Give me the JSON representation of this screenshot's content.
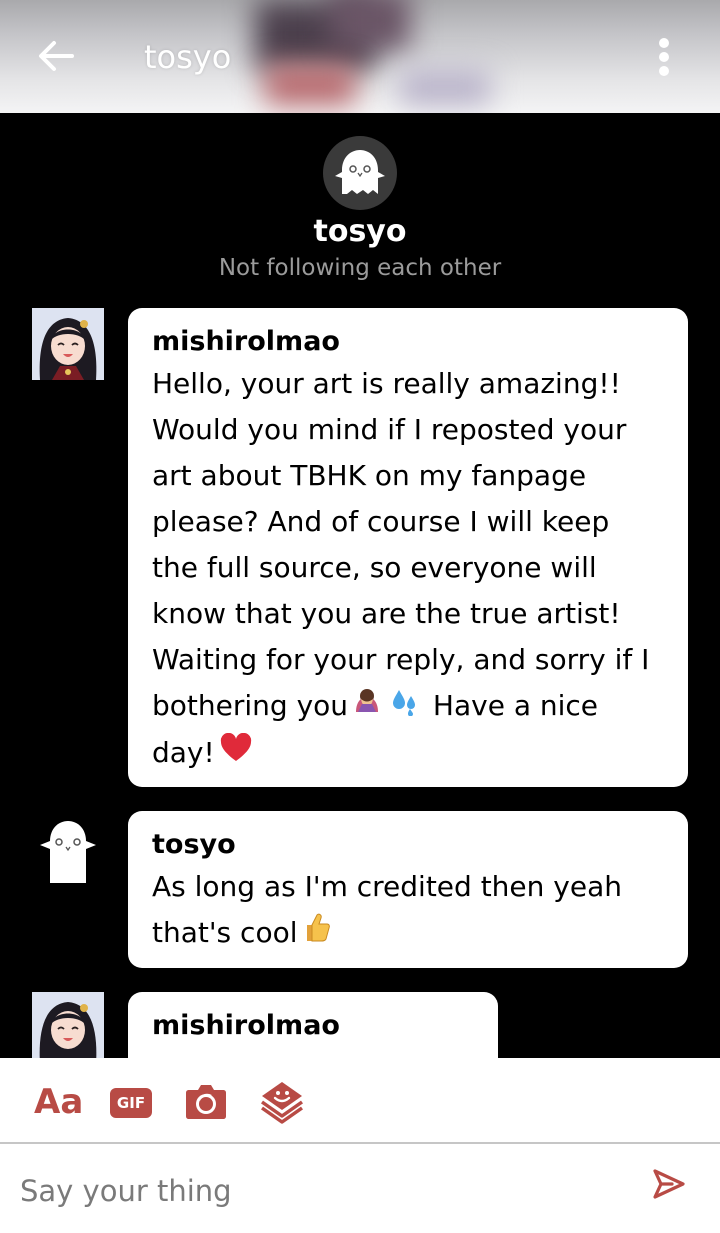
{
  "header": {
    "title": "tosyo",
    "back_icon": "arrow-left-icon",
    "more_icon": "more-vertical-icon"
  },
  "profile": {
    "name": "tosyo",
    "relationship": "Not following each other"
  },
  "messages": [
    {
      "sender": "mishirolmao",
      "avatar": "anime-girl-avatar",
      "text_before_emoji": "Hello, your art is really amazing!! Would you mind if I reposted your art about TBHK on my fanpage please? And of course I will keep the full source, so everyone will know that you are the true artist! Waiting for your reply, and sorry if I bothering you",
      "text_after_emoji": "Have a nice day!",
      "emojis": [
        "bowing-woman-emoji",
        "sweat-droplets-emoji",
        "red-heart-emoji"
      ]
    },
    {
      "sender": "tosyo",
      "avatar": "ghost-avatar",
      "text": "As long as I'm credited then yeah that's cool",
      "emojis": [
        "thumbs-up-emoji"
      ]
    },
    {
      "sender": "mishirolmao",
      "avatar": "anime-girl-avatar",
      "text": ""
    }
  ],
  "composer": {
    "text_tool": "Aa",
    "gif_tool": "GIF",
    "camera_icon": "camera-icon",
    "sticker_icon": "sticker-icon",
    "placeholder": "Say your thing",
    "send_icon": "send-icon"
  },
  "colors": {
    "accent": "#b84b45",
    "background": "#000000",
    "bubble": "#ffffff",
    "subtext": "#9b9b9b"
  }
}
